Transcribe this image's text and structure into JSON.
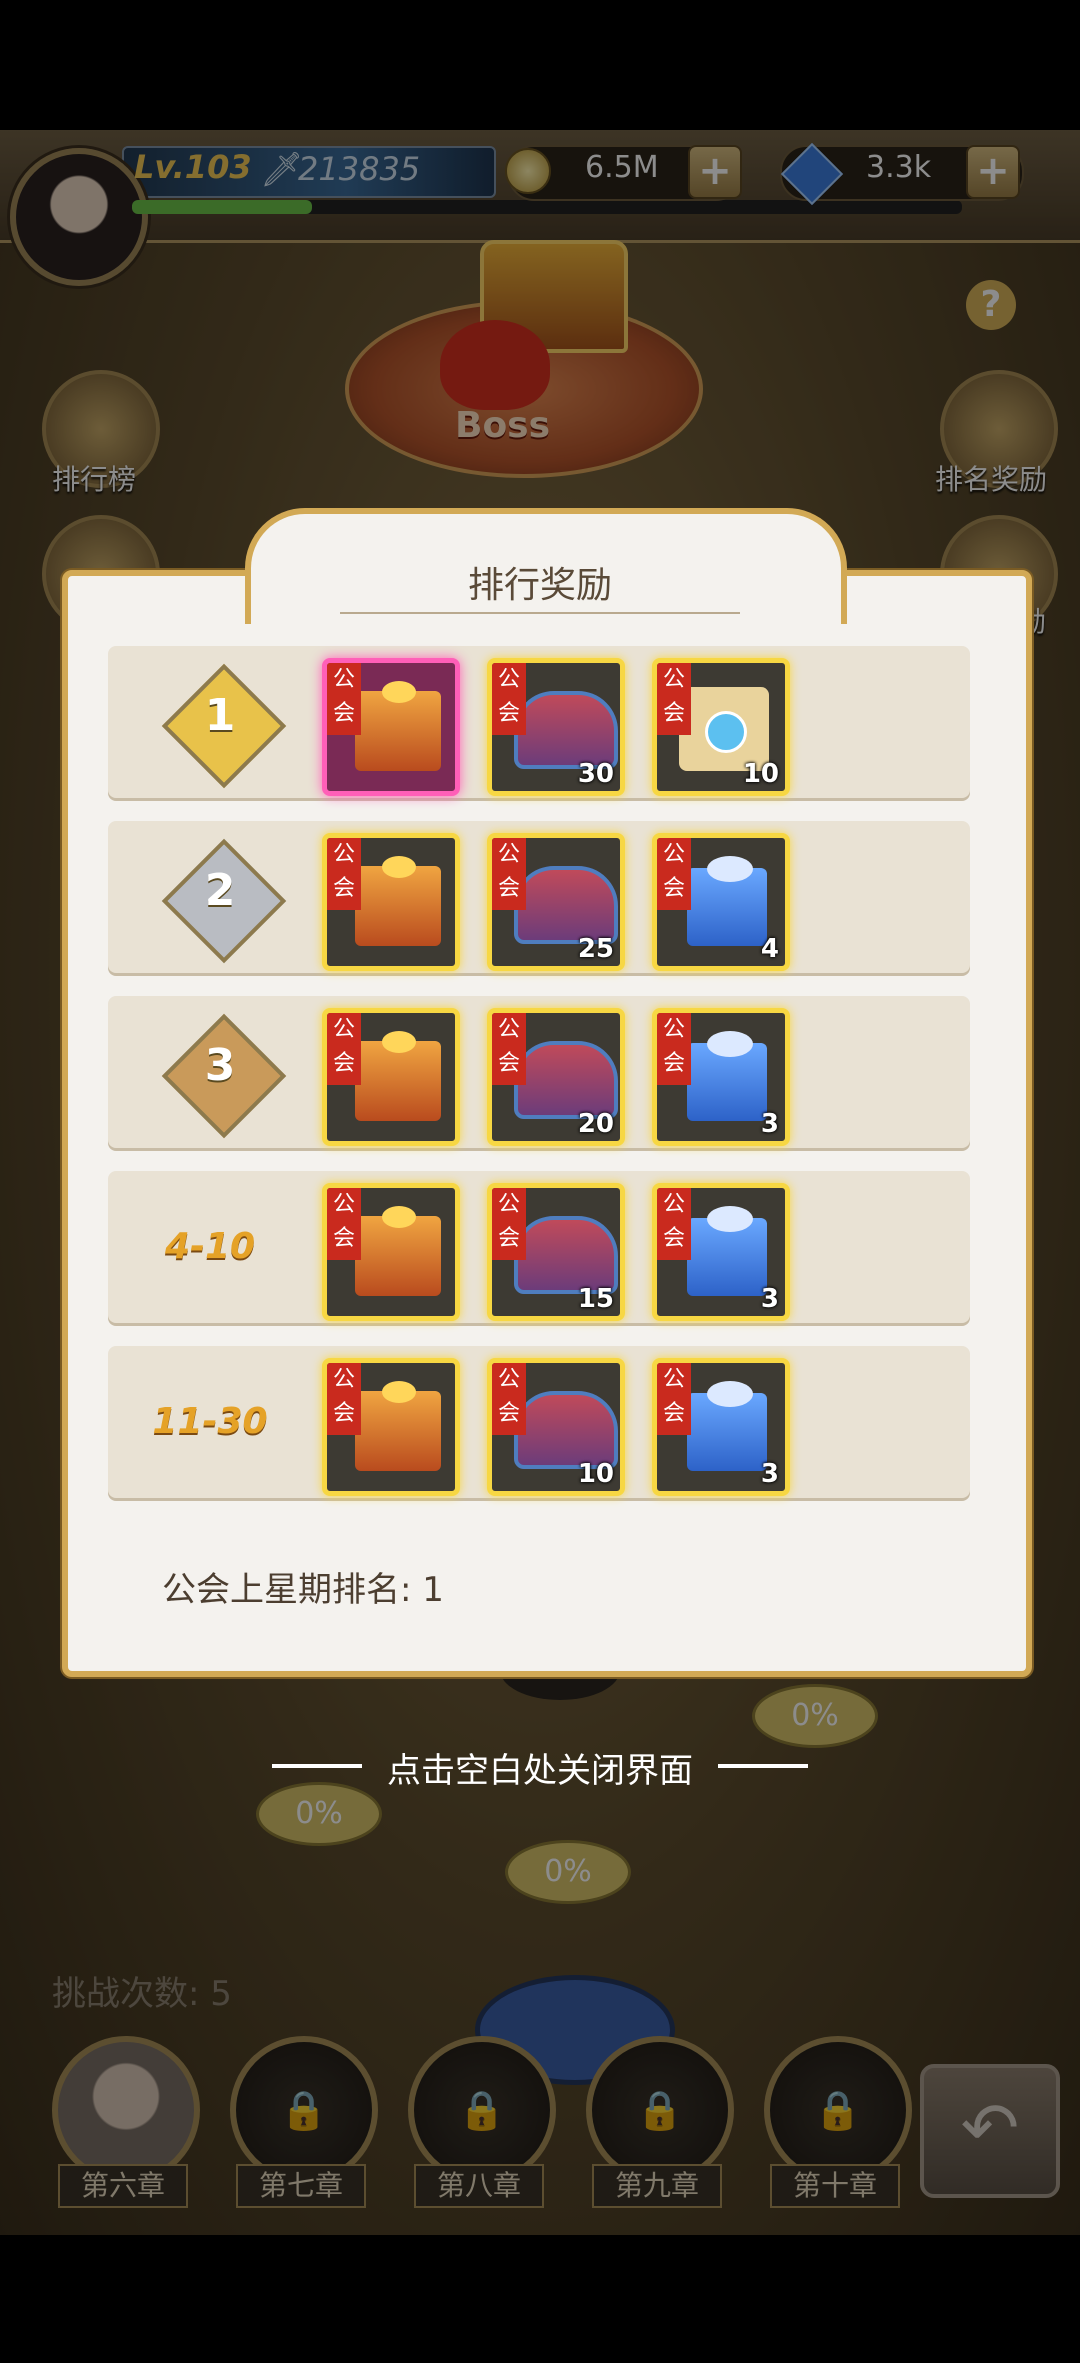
{
  "hud": {
    "level": "Lv.103",
    "power": "213835",
    "gold": "6.5M",
    "diamonds": "3.3k",
    "gold_add": "+",
    "diamond_add": "+"
  },
  "board": {
    "boss_label": "Boss",
    "help": "?",
    "leaderboard_label": "排行榜",
    "rank_reward_label": "排名奖励",
    "reward_label_partial": "励",
    "progress": [
      "0%",
      "0%",
      "0%"
    ]
  },
  "dialog": {
    "title": "排行奖励",
    "guild_tag": "公会",
    "rows": [
      {
        "rank": "1",
        "items": [
          {
            "type": "guild-gift-premium",
            "count": ""
          },
          {
            "type": "cannon-cart",
            "count": "30"
          },
          {
            "type": "gem-scroll",
            "count": "10"
          }
        ]
      },
      {
        "rank": "2",
        "items": [
          {
            "type": "guild-gift",
            "count": ""
          },
          {
            "type": "cannon-cart",
            "count": "25"
          },
          {
            "type": "blue-gift",
            "count": "4"
          }
        ]
      },
      {
        "rank": "3",
        "items": [
          {
            "type": "guild-gift",
            "count": ""
          },
          {
            "type": "cannon-cart",
            "count": "20"
          },
          {
            "type": "blue-gift",
            "count": "3"
          }
        ]
      },
      {
        "rank": "4-10",
        "items": [
          {
            "type": "guild-gift",
            "count": ""
          },
          {
            "type": "cannon-cart",
            "count": "15"
          },
          {
            "type": "blue-gift",
            "count": "3"
          }
        ]
      },
      {
        "rank": "11-30",
        "items": [
          {
            "type": "guild-gift",
            "count": ""
          },
          {
            "type": "cannon-cart",
            "count": "10"
          },
          {
            "type": "blue-gift",
            "count": "3"
          }
        ]
      }
    ],
    "last_week_rank": "公会上星期排名: 1"
  },
  "close_hint": "点击空白处关闭界面",
  "challenge_count": "挑战次数: 5",
  "chapters": [
    "第六章",
    "第七章",
    "第八章",
    "第九章",
    "第十章"
  ],
  "colors": {
    "gold_border": "#d2a955",
    "item_glow": "#f7d743",
    "guild_red": "#c92a1e"
  }
}
